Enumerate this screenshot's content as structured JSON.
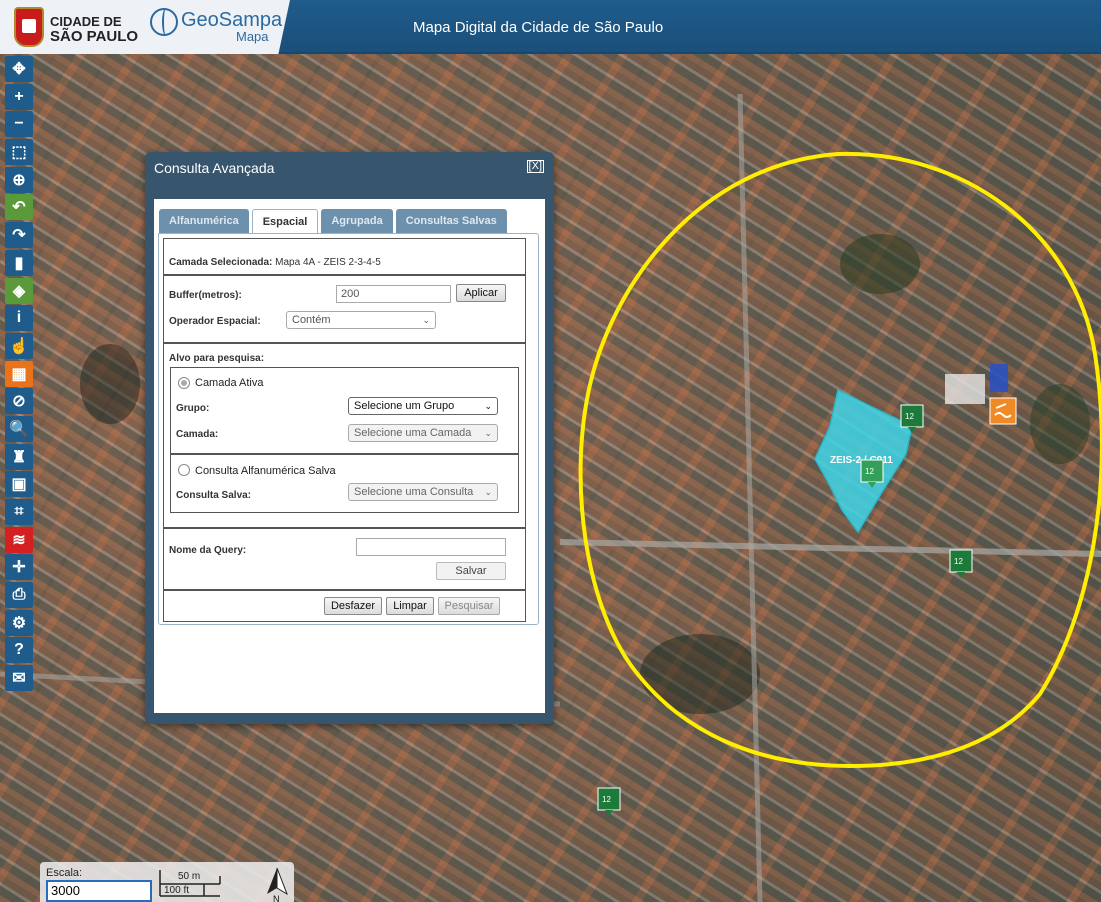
{
  "header": {
    "city_line1": "CIDADE DE",
    "city_line2": "SÃO PAULO",
    "brand": "GeoSampa",
    "brand_sub": "Mapa",
    "title": "Mapa Digital da Cidade de São Paulo"
  },
  "toolbar": {
    "tools": [
      "pan-icon",
      "zoom-in-icon",
      "zoom-out-icon",
      "zoom-box-icon",
      "globe-icon",
      "undo-icon",
      "redo-icon",
      "bookmark-icon",
      "layers-icon",
      "info-icon",
      "hand-pointer-icon",
      "table-icon",
      "tools-icon",
      "search-icon",
      "stamp-icon",
      "save-icon",
      "measure-icon",
      "terrain-icon",
      "route-icon",
      "print-icon",
      "settings-icon",
      "help-icon",
      "mail-icon"
    ],
    "glyphs": [
      "✥",
      "+",
      "−",
      "⬚",
      "⊕",
      "↶",
      "↷",
      "▮",
      "◈",
      "i",
      "☝",
      "▦",
      "⊘",
      "🔍",
      "♜",
      "▣",
      "⌗",
      "≋",
      "✛",
      "⎙",
      "⚙",
      "?",
      "✉"
    ]
  },
  "dialog": {
    "title": "Consulta Avançada",
    "close": "[X]",
    "tabs": [
      "Alfanumérica",
      "Espacial",
      "Agrupada",
      "Consultas Salvas"
    ],
    "active_tab": "Espacial",
    "camada_selecionada_label": "Camada Selecionada:",
    "camada_selecionada_value": "Mapa 4A - ZEIS 2-3-4-5",
    "buffer_label": "Buffer(metros):",
    "buffer_value": "200",
    "aplicar": "Aplicar",
    "operador_label": "Operador Espacial:",
    "operador_value": "Contém",
    "alvo_label": "Alvo para pesquisa:",
    "camada_ativa": "Camada Ativa",
    "grupo_label": "Grupo:",
    "grupo_value": "Selecione um Grupo",
    "camada_label": "Camada:",
    "camada_value": "Selecione uma Camada",
    "consulta_alfa_salva": "Consulta Alfanumérica Salva",
    "consulta_salva_label": "Consulta Salva:",
    "consulta_salva_value": "Selecione uma Consulta",
    "nome_query_label": "Nome da Query:",
    "nome_query_value": "",
    "salvar": "Salvar",
    "desfazer": "Desfazer",
    "limpar": "Limpar",
    "pesquisar": "Pesquisar"
  },
  "map": {
    "zone_label": "ZEIS-2 / C011",
    "buffer_color": "#ffee00",
    "zone_color": "#3fd6e8",
    "marker_color": "#1e7a3a"
  },
  "scale": {
    "label": "Escala:",
    "value": "3000",
    "metric": "50 m",
    "imperial": "100 ft",
    "north": "N"
  }
}
